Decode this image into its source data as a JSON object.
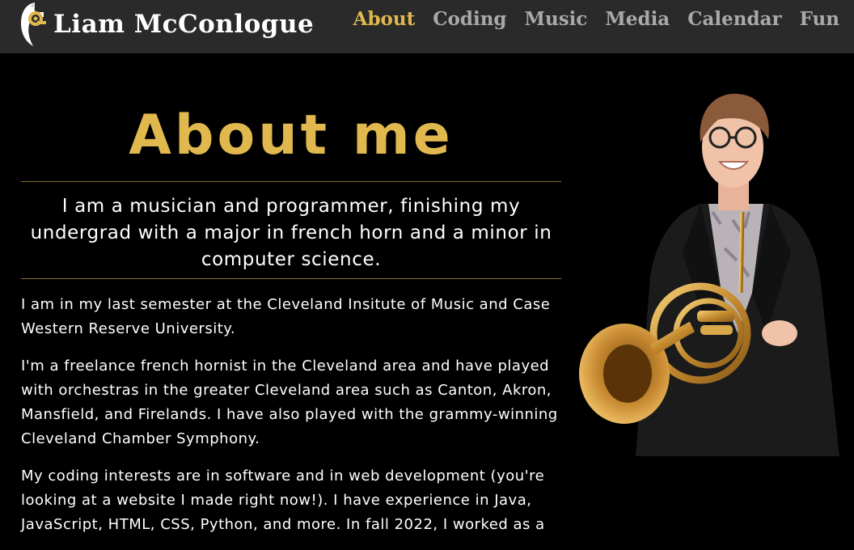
{
  "header": {
    "brand_name": "Liam McConlogue",
    "logo_icon": "french-horn-logo-icon",
    "nav": [
      {
        "label": "About",
        "active": true
      },
      {
        "label": "Coding",
        "active": false
      },
      {
        "label": "Music",
        "active": false
      },
      {
        "label": "Media",
        "active": false
      },
      {
        "label": "Calendar",
        "active": false
      },
      {
        "label": "Fun",
        "active": false
      }
    ]
  },
  "main": {
    "title": "About me",
    "lead": "I am a musician and programmer, finishing my undergrad with a major in french horn and a minor in computer science.",
    "paragraphs": [
      "I am in my last semester at the Cleveland Insitute of Music and Case Western Reserve University.",
      "I'm a freelance french hornist in the Cleveland area and have played with orchestras in the greater Cleveland area such as Canton, Akron, Mansfield, and Firelands. I have also played with the grammy-winning Cleveland Chamber Symphony.",
      "My coding interests are in software and in web development (you're looking at a website I made right now!). I have experience in Java, JavaScript, HTML, CSS, Python, and more. In fall 2022, I worked as a"
    ]
  },
  "portrait": {
    "subject": "portrait photo of man holding french horn"
  },
  "colors": {
    "accent": "#e0b84e",
    "navbar_bg": "#2a2a2a",
    "nav_inactive": "#a9a9a9",
    "page_bg": "#000000",
    "text": "#ffffff"
  }
}
